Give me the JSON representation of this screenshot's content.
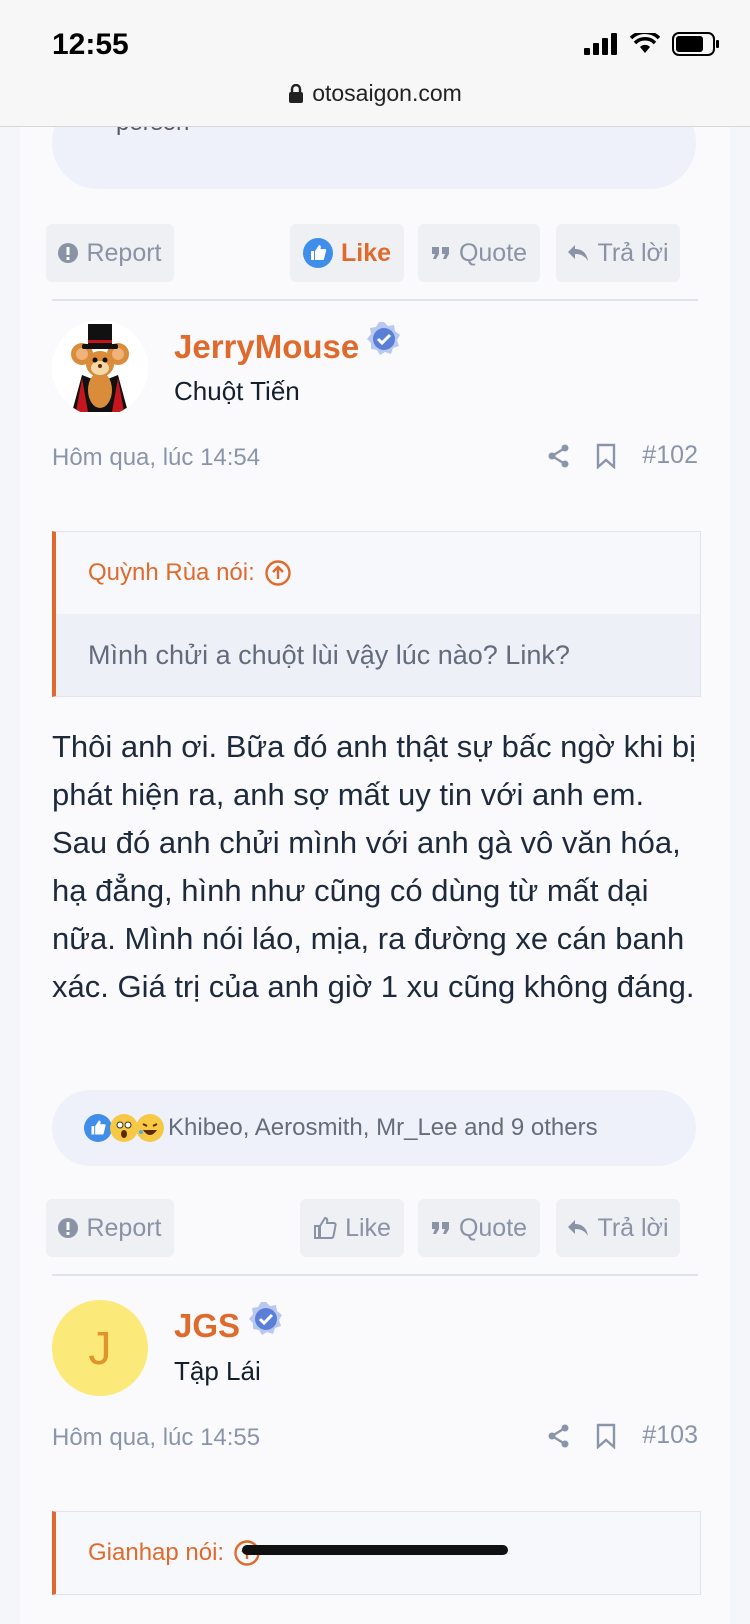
{
  "status": {
    "time": "12:55"
  },
  "browser": {
    "url": "otosaigon.com"
  },
  "prev_post": {
    "reactions_tail": "person",
    "buttons": {
      "report": "Report",
      "like": "Like",
      "quote": "Quote",
      "reply": "Trả lời"
    }
  },
  "posts": [
    {
      "username": "JerryMouse",
      "user_title": "Chuột Tiến",
      "time": "Hôm qua, lúc 14:54",
      "number": "#102",
      "quote": {
        "author": "Quỳnh Rùa nói:",
        "text": "Mình chửi a chuột lùi vậy lúc nào? Link?"
      },
      "message": "Thôi anh ơi. Bữa đó anh thật sự bấc ngờ khi bị phát hiện ra, anh sợ mất uy tin với anh em. Sau đó anh chửi mình với anh gà vô văn hóa, hạ đẳng, hình như cũng có dùng từ mất dại nữa. Mình nói láo, mịa, ra đường xe cán banh xác. Giá trị của anh giờ 1 xu cũng không đáng.",
      "reactions": "Khibeo, Aerosmith, Mr_Lee and 9 others",
      "buttons": {
        "report": "Report",
        "like": "Like",
        "quote": "Quote",
        "reply": "Trả lời"
      }
    },
    {
      "username": "JGS",
      "avatar_letter": "J",
      "user_title": "Tập Lái",
      "time": "Hôm qua, lúc 14:55",
      "number": "#103",
      "quote": {
        "author": "Gianhap nói:"
      }
    }
  ],
  "colors": {
    "accent": "#e06a2c",
    "muted": "#8a95ab",
    "verified": "#5b7fd6"
  }
}
